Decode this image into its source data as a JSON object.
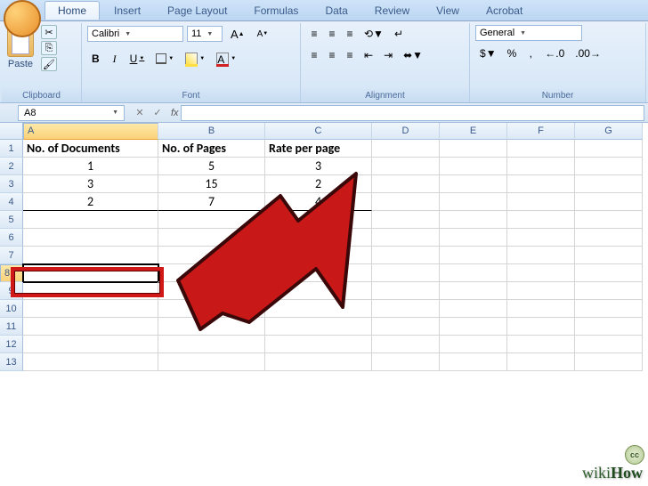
{
  "tabs": [
    "Home",
    "Insert",
    "Page Layout",
    "Formulas",
    "Data",
    "Review",
    "View",
    "Acrobat"
  ],
  "active_tab": "Home",
  "clipboard": {
    "paste": "Paste",
    "label": "Clipboard"
  },
  "font": {
    "name": "Calibri",
    "size": "11",
    "grow": "A",
    "shrink": "A",
    "bold": "B",
    "italic": "I",
    "underline": "U",
    "label": "Font"
  },
  "alignment": {
    "label": "Alignment"
  },
  "number": {
    "format": "General",
    "currency": "$",
    "percent": "%",
    "comma": ",",
    "label": "Number"
  },
  "namebox": "A8",
  "fx": "fx",
  "columns": [
    "A",
    "B",
    "C",
    "D",
    "E",
    "F",
    "G"
  ],
  "rows": [
    "1",
    "2",
    "3",
    "4",
    "5",
    "6",
    "7",
    "8",
    "9",
    "10",
    "11",
    "12",
    "13"
  ],
  "sheet": {
    "headers": [
      "No. of Documents",
      "No. of Pages",
      "Rate per page"
    ],
    "data": [
      [
        "1",
        "5",
        "3"
      ],
      [
        "3",
        "15",
        "2"
      ],
      [
        "2",
        "7",
        "4"
      ]
    ]
  },
  "active_cell": {
    "row": 8,
    "col": "A"
  },
  "watermark": {
    "prefix": "wiki",
    "suffix": "How"
  },
  "licence": "cc"
}
